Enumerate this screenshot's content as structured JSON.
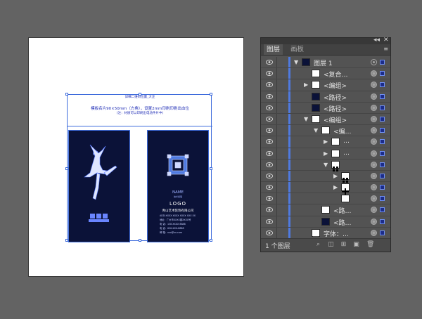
{
  "artboard": {
    "text_line1": "详细二维码位置_大正",
    "text_line2": "模板名片90×50mm（方角），设置2mm印刷印刷出血位",
    "text_line3": "(注：材质可以印刷出电池件片中)"
  },
  "card_right": {
    "name": "NAME",
    "subtitle": "技术经理",
    "logo": "LOGO",
    "company": "青山艺术装饰有限公司",
    "line1": "ADD:XXXX XXXX XXXX XXX XX",
    "line2": "地址：广州市XXXX路XXXX号",
    "line3": "电 话：138 XXXX 8888",
    "line4": "电 话：020-XXX-8888",
    "line5": "邮 箱：xxx@xx.com"
  },
  "panel": {
    "tabs": [
      "图层",
      "画板"
    ],
    "collapse_glyph": "◂◂",
    "close_glyph": "✕",
    "menu_glyph": "≡",
    "footer_text": "1 个图层",
    "layers": [
      {
        "label": "图层 1",
        "depth": 0,
        "expander": "▼",
        "thumb": "layer",
        "target": "hollow"
      },
      {
        "label": "<复合…",
        "depth": 1,
        "expander": "",
        "thumb": "white",
        "target": "filled"
      },
      {
        "label": "<编组>",
        "depth": 1,
        "expander": "▶",
        "thumb": "white",
        "target": "filled"
      },
      {
        "label": "<路径>",
        "depth": 1,
        "expander": "",
        "thumb": "dark",
        "target": "filled"
      },
      {
        "label": "<路径>",
        "depth": 1,
        "expander": "",
        "thumb": "dark",
        "target": "filled"
      },
      {
        "label": "<编组>",
        "depth": 1,
        "expander": "▼",
        "thumb": "white",
        "target": "filled"
      },
      {
        "label": "<编…",
        "depth": 2,
        "expander": "▼",
        "thumb": "white",
        "target": "filled"
      },
      {
        "label": "…",
        "depth": 3,
        "expander": "▶",
        "thumb": "white",
        "target": "filled"
      },
      {
        "label": "…",
        "depth": 3,
        "expander": "▶",
        "thumb": "white",
        "target": "filled"
      },
      {
        "label": "",
        "depth": 3,
        "expander": "▼",
        "thumb": "pattern",
        "target": "filled"
      },
      {
        "label": "",
        "depth": 4,
        "expander": "▶",
        "thumb": "pattern",
        "target": "filled"
      },
      {
        "label": "",
        "depth": 4,
        "expander": "▶",
        "thumb": "cross",
        "target": "filled"
      },
      {
        "label": "",
        "depth": 4,
        "expander": "",
        "thumb": "white",
        "target": "filled"
      },
      {
        "label": "<路…",
        "depth": 2,
        "expander": "",
        "thumb": "white",
        "target": "filled"
      },
      {
        "label": "<路…",
        "depth": 2,
        "expander": "",
        "thumb": "dark",
        "target": "filled"
      },
      {
        "label": "字体：…",
        "depth": 1,
        "expander": "",
        "thumb": "text",
        "target": "filled"
      }
    ]
  },
  "colors": {
    "card_bg": "#0b1238",
    "accent": "#3d6bdc",
    "layer_color": "#4f7ae0"
  }
}
